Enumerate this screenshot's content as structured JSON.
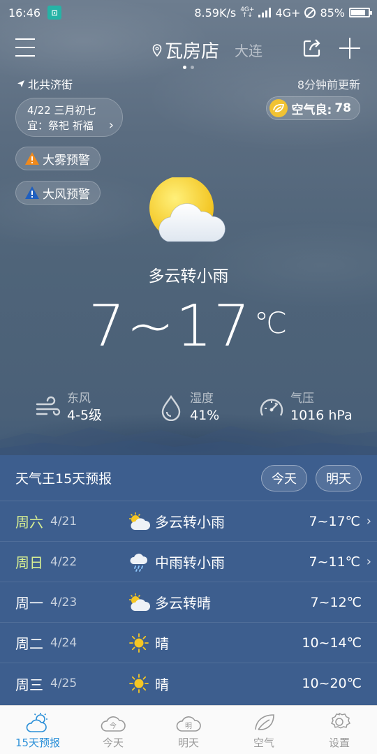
{
  "status_bar": {
    "time": "16:46",
    "speed": "8.59K/s",
    "net_tiny_top": "4G+",
    "net_tiny_bottom": "↑↓",
    "network": "4G+",
    "battery": "85%",
    "battery_level": 0.85
  },
  "header": {
    "city": "瓦房店",
    "next_city": "大连",
    "page_dots": 2,
    "active_dot": 0
  },
  "location": {
    "street": "北共济街",
    "updated": "8分钟前更新"
  },
  "almanac": {
    "date_line": "4/22  三月初七",
    "yi_line": "宜：祭祀 祈福",
    "chevron": "›"
  },
  "aqi": {
    "label": "空气良:",
    "value": "78",
    "color": "#f1c232"
  },
  "alerts": [
    {
      "label": "大雾预警",
      "color": "#f08a1c"
    },
    {
      "label": "大风预警",
      "color": "#1f5fbf"
    }
  ],
  "current": {
    "condition": "多云转小雨",
    "temp_range": "7~17",
    "unit": "℃",
    "icon": "partly-cloudy-icon"
  },
  "metrics": [
    {
      "icon": "wind-icon",
      "label": "东风",
      "value": "4-5级"
    },
    {
      "icon": "humidity-icon",
      "label": "湿度",
      "value": "41%"
    },
    {
      "icon": "pressure-icon",
      "label": "气压",
      "value": "1016 hPa"
    }
  ],
  "forecast": {
    "title": "天气王15天预报",
    "today_btn": "今天",
    "tomorrow_btn": "明天",
    "days": [
      {
        "day": "周六",
        "date": "4/21",
        "icon": "partly-cloudy-icon",
        "weather": "多云转小雨",
        "range": "7~17℃",
        "chevron": "›",
        "weekend": true
      },
      {
        "day": "周日",
        "date": "4/22",
        "icon": "rain-icon",
        "weather": "中雨转小雨",
        "range": "7~11℃",
        "chevron": "›",
        "weekend": true
      },
      {
        "day": "周一",
        "date": "4/23",
        "icon": "partly-cloudy-icon",
        "weather": "多云转晴",
        "range": "7~12℃",
        "chevron": "",
        "weekend": false
      },
      {
        "day": "周二",
        "date": "4/24",
        "icon": "sunny-icon",
        "weather": "晴",
        "range": "10~14℃",
        "chevron": "",
        "weekend": false
      },
      {
        "day": "周三",
        "date": "4/25",
        "icon": "sunny-icon",
        "weather": "晴",
        "range": "10~20℃",
        "chevron": "",
        "weekend": false
      }
    ]
  },
  "nav": {
    "items": [
      {
        "label": "15天预报",
        "icon": "forecast-icon",
        "active": true
      },
      {
        "label": "今天",
        "icon": "today-icon",
        "glyph": "今",
        "active": false
      },
      {
        "label": "明天",
        "icon": "tomorrow-icon",
        "glyph": "明",
        "active": false
      },
      {
        "label": "空气",
        "icon": "air-leaf-icon",
        "active": false
      },
      {
        "label": "设置",
        "icon": "settings-gear-icon",
        "active": false
      }
    ],
    "accent": "#2a8fd8",
    "inactive": "#9a9a9a"
  }
}
